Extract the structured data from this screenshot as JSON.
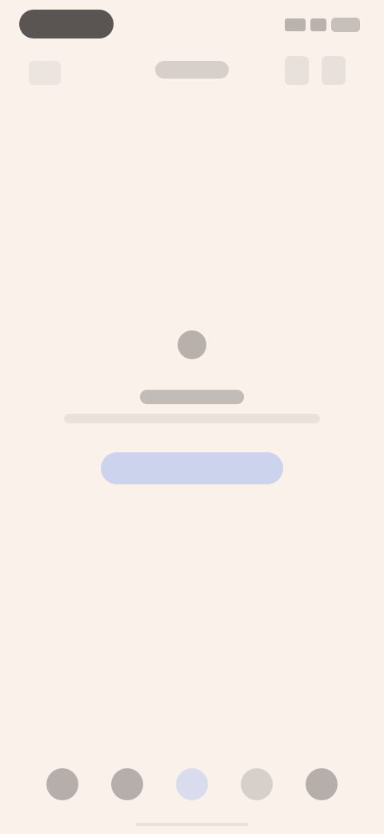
{
  "status_bar": {
    "icons": [
      "signal-icon",
      "wifi-icon",
      "battery-icon"
    ]
  },
  "app_bar": {
    "left_icon": "menu-icon",
    "actions": [
      "search-icon",
      "more-icon"
    ]
  },
  "empty_state": {
    "icon": "empty-icon"
  },
  "bottom_nav": {
    "items": [
      {
        "icon": "home-icon"
      },
      {
        "icon": "explore-icon"
      },
      {
        "icon": "add-icon",
        "active": true
      },
      {
        "icon": "activity-icon"
      },
      {
        "icon": "profile-icon"
      }
    ]
  },
  "colors": {
    "background": "#faf1ea",
    "accent": "#ccd3ec",
    "dark": "#5a5552"
  }
}
